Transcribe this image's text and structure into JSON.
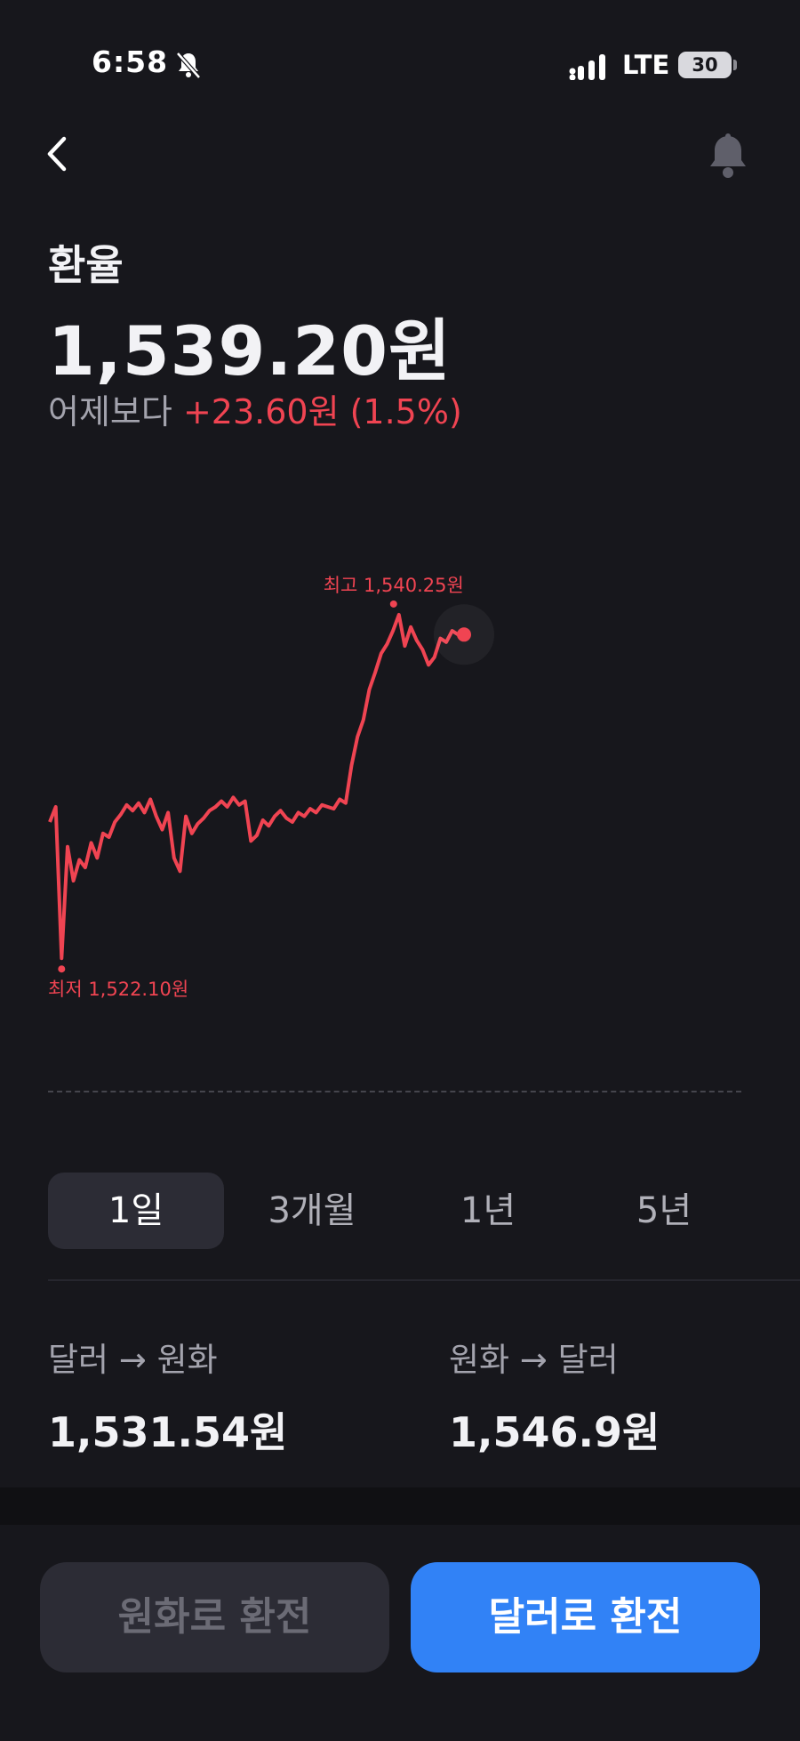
{
  "status_bar": {
    "time": "6:58",
    "network": "LTE",
    "battery": "30"
  },
  "header": {
    "title": "환율",
    "rate": "1,539.20원",
    "change_label": "어제보다",
    "change_value": "+23.60원 (1.5%)"
  },
  "chart_data": {
    "type": "line",
    "title": "",
    "series": [
      {
        "color": "#f04452",
        "values": [
          1529.3,
          1530.1,
          1522.1,
          1528.0,
          1526.2,
          1527.3,
          1526.9,
          1528.2,
          1527.4,
          1528.7,
          1528.5,
          1529.3,
          1529.7,
          1530.2,
          1529.9,
          1530.3,
          1529.8,
          1530.5,
          1529.6,
          1528.9,
          1529.8,
          1527.4,
          1526.7,
          1529.6,
          1528.7,
          1529.2,
          1529.5,
          1529.9,
          1530.1,
          1530.4,
          1530.1,
          1530.6,
          1530.2,
          1530.4,
          1528.3,
          1528.6,
          1529.4,
          1529.1,
          1529.6,
          1529.9,
          1529.5,
          1529.3,
          1529.8,
          1529.6,
          1530.0,
          1529.8,
          1530.2,
          1530.1,
          1530.0,
          1530.5,
          1530.3,
          1532.3,
          1533.8,
          1534.7,
          1536.3,
          1537.2,
          1538.2,
          1538.7,
          1539.4,
          1540.25,
          1538.6,
          1539.6,
          1538.9,
          1538.4,
          1537.6,
          1538.0,
          1539.0,
          1538.8,
          1539.4,
          1539.2,
          1539.2
        ]
      }
    ],
    "annotations": {
      "max_label": "최고 1,540.25원",
      "min_label": "최저 1,522.10원"
    },
    "ylim": [
      1521.5,
      1541.0
    ],
    "grid": false
  },
  "periods": [
    {
      "label": "1일",
      "selected": true
    },
    {
      "label": "3개월",
      "selected": false
    },
    {
      "label": "1년",
      "selected": false
    },
    {
      "label": "5년",
      "selected": false
    }
  ],
  "conversion": {
    "usd_to_krw_label": "달러 → 원화",
    "usd_to_krw_value": "1,531.54원",
    "krw_to_usd_label": "원화 → 달러",
    "krw_to_usd_value": "1,546.9원"
  },
  "buttons": {
    "krw_label": "원화로 환전",
    "usd_label": "달러로 환전"
  }
}
